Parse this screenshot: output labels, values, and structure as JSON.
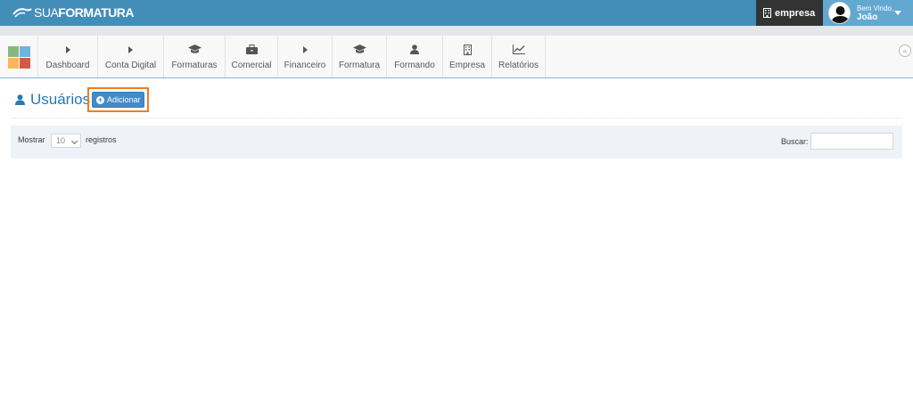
{
  "header": {
    "logo_part1": "SUA",
    "logo_part2": "FORMATURA",
    "company_label": "empresa",
    "welcome": "Bem Vindo,",
    "user_name": "João"
  },
  "nav": {
    "items": [
      {
        "label": "Dashboard",
        "icon": "caret-right-icon"
      },
      {
        "label": "Conta Digital",
        "icon": "caret-right-icon"
      },
      {
        "label": "Formaturas",
        "icon": "graduation-cap-icon"
      },
      {
        "label": "Comercial",
        "icon": "briefcase-icon"
      },
      {
        "label": "Financeiro",
        "icon": "caret-right-icon"
      },
      {
        "label": "Formatura",
        "icon": "graduation-cap-icon"
      },
      {
        "label": "Formando",
        "icon": "user-icon"
      },
      {
        "label": "Empresa",
        "icon": "building-icon"
      },
      {
        "label": "Relatórios",
        "icon": "line-chart-icon"
      }
    ],
    "collapse_icon": "double-angle-left-icon"
  },
  "page": {
    "title": "Usuários",
    "title_icon": "user-icon",
    "add_button": "Adicionar"
  },
  "table_controls": {
    "show_label": "Mostrar",
    "page_size": "10",
    "records_label": "registros",
    "search_label": "Buscar:",
    "search_value": ""
  },
  "colors": {
    "header_bg": "#438eb9",
    "accent": "#2679b5",
    "button": "#428bca",
    "highlight": "#f07d1e"
  }
}
